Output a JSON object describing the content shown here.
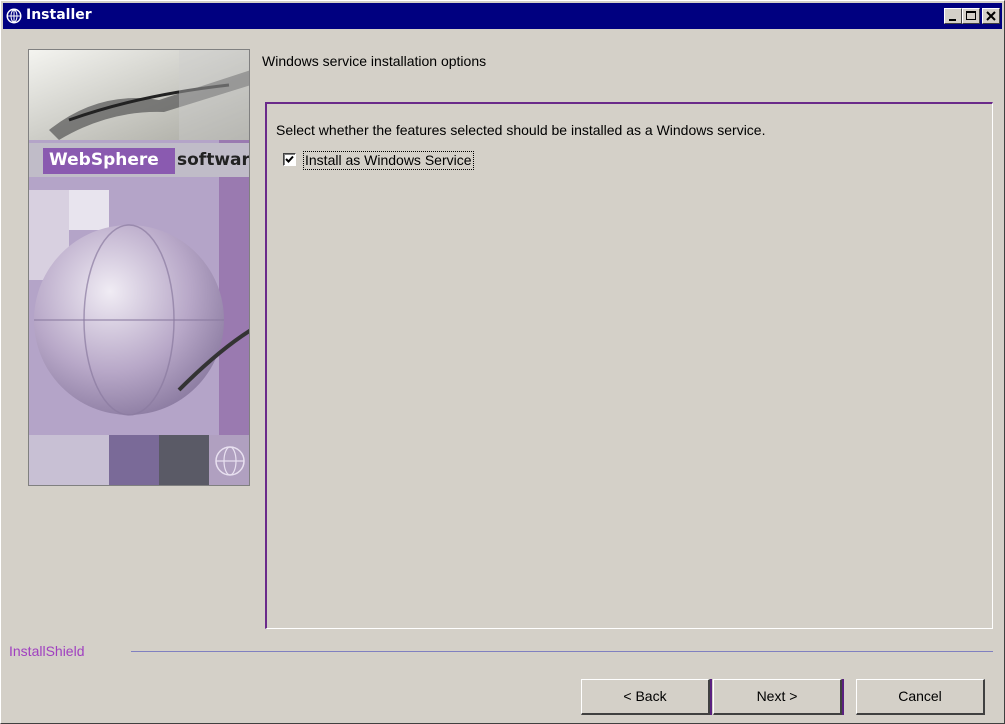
{
  "window": {
    "title": "Installer"
  },
  "banner": {
    "brand": "WebSphere",
    "product": "software"
  },
  "page": {
    "heading": "Windows service installation options",
    "description": "Select whether the features selected should be installed as a Windows service.",
    "checkbox": {
      "label": "Install as Windows Service",
      "checked": true
    }
  },
  "footer": {
    "brand": "InstallShield"
  },
  "buttons": {
    "back": "< Back",
    "next": "Next >",
    "cancel": "Cancel"
  },
  "colors": {
    "titlebar": "#000080",
    "accent": "#6a2a8a",
    "brand_text": "#a040c0"
  }
}
